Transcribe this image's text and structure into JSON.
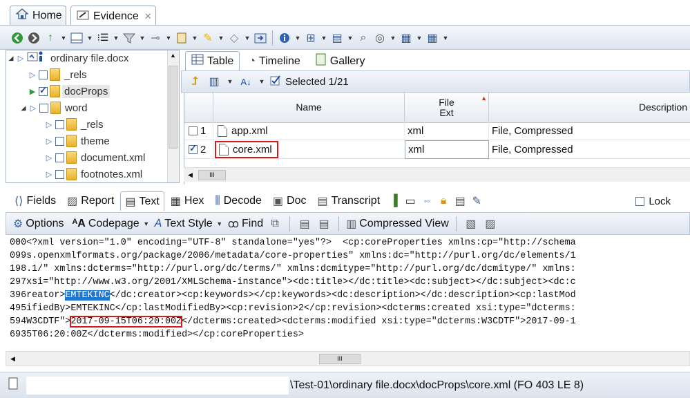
{
  "tabs": [
    {
      "label": "Home",
      "icon": "home-icon"
    },
    {
      "label": "Evidence",
      "icon": "evidence-icon",
      "close": "✕"
    }
  ],
  "tree": {
    "root": "ordinary file.docx",
    "items": [
      {
        "label": "_rels",
        "checked": false
      },
      {
        "label": "docProps",
        "checked": true,
        "selected": true
      },
      {
        "label": "word",
        "checked": false,
        "expanded": true
      },
      {
        "label": "_rels",
        "checked": false
      },
      {
        "label": "theme",
        "checked": false
      },
      {
        "label": "document.xml",
        "checked": false
      },
      {
        "label": "footnotes.xml",
        "checked": false
      }
    ]
  },
  "view_tabs": [
    {
      "label": "Table",
      "active": true
    },
    {
      "label": "Timeline"
    },
    {
      "label": "Gallery"
    }
  ],
  "grid_toolbar": {
    "selected": "Selected 1/21"
  },
  "grid": {
    "columns": [
      "Name",
      "File\nExt",
      "Description"
    ],
    "rows": [
      {
        "num": "1",
        "name": "app.xml",
        "ext": "xml",
        "desc": "File, Compressed",
        "checked": false
      },
      {
        "num": "2",
        "name": "core.xml",
        "ext": "xml",
        "desc": "File, Compressed",
        "checked": true
      }
    ],
    "scroll_label": "III"
  },
  "lower_tabs": [
    "Fields",
    "Report",
    "Text",
    "Hex",
    "Decode",
    "Doc",
    "Transcript"
  ],
  "lower_active": "Text",
  "lock_label": "Lock",
  "text_toolbar": {
    "options": "Options",
    "codepage": "Codepage",
    "text_style": "Text Style",
    "find": "Find",
    "compressed": "Compressed View"
  },
  "text_lines": [
    {
      "off": "000",
      "pre": "<?xml version=\"1.0\" encoding=\"UTF-8\" standalone=\"yes\"?>  <cp:coreProperties xmlns:cp=\"http://schema"
    },
    {
      "off": "099",
      "pre": "s.openxmlformats.org/package/2006/metadata/core-properties\" xmlns:dc=\"http://purl.org/dc/elements/1"
    },
    {
      "off": "198",
      "pre": ".1/\" xmlns:dcterms=\"http://purl.org/dc/terms/\" xmlns:dcmitype=\"http://purl.org/dc/dcmitype/\" xmlns:"
    },
    {
      "off": "297",
      "pre": "xsi=\"http://www.w3.org/2001/XMLSchema-instance\"><dc:title></dc:title><dc:subject></dc:subject><dc:c"
    },
    {
      "off": "396",
      "pre": "reator>",
      "hl": "EMTEKINC",
      "post": "</dc:creator><cp:keywords></cp:keywords><dc:description></dc:description><cp:lastMod"
    },
    {
      "off": "495",
      "pre": "ifiedBy>EMTEKINC</cp:lastModifiedBy><cp:revision>2</cp:revision><dcterms:created xsi:type=\"dcterms:"
    },
    {
      "off": "594",
      "pre": "W3CDTF\">",
      "box": "2017-09-15T06:20:00Z",
      "post": "</dcterms:created><dcterms:modified xsi:type=\"dcterms:W3CDTF\">2017-09-1"
    },
    {
      "off": "693",
      "pre": "5T06:20:00Z</dcterms:modified></cp:coreProperties>"
    }
  ],
  "hscroll_label": "III",
  "status_path": "\\Test-01\\ordinary file.docx\\docProps\\core.xml (FO 403 LE 8)"
}
